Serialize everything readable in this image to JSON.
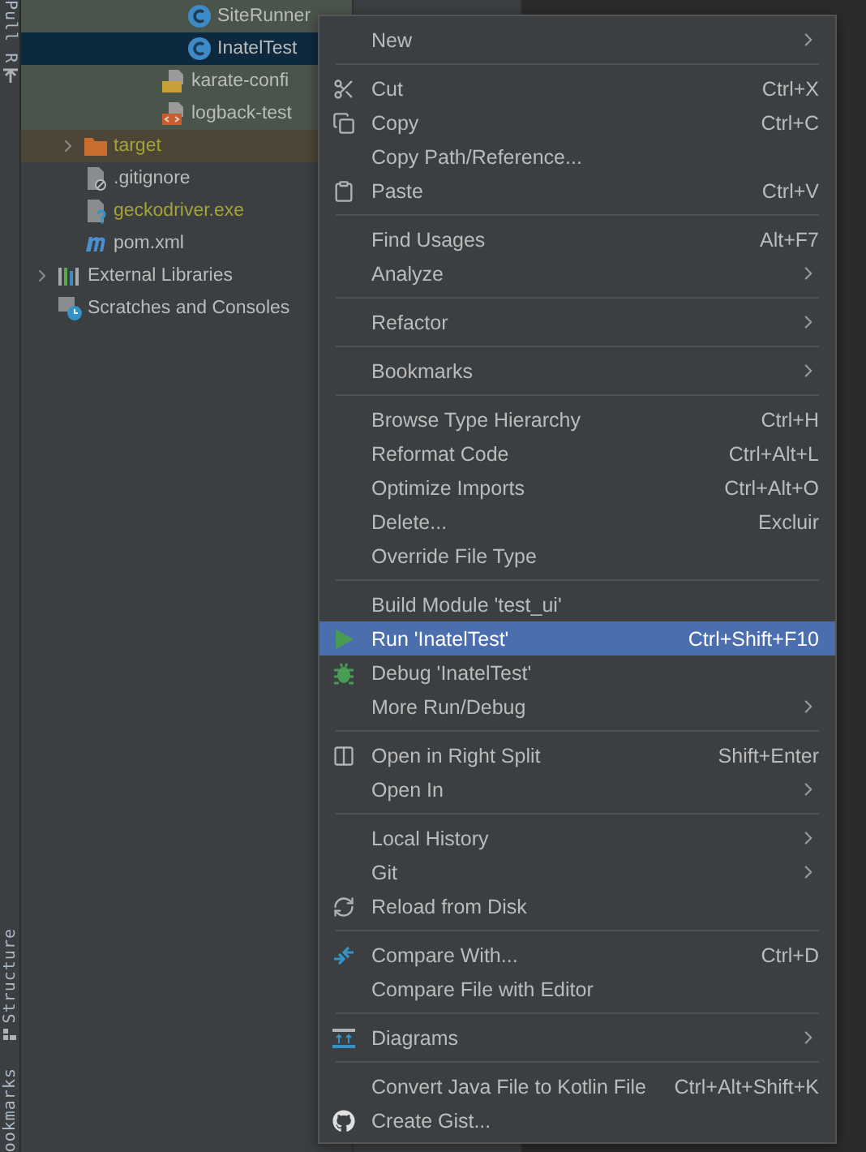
{
  "tool_strip": {
    "top_label": "Pull R",
    "bottom_labels": [
      "Structure",
      "ookmarks"
    ]
  },
  "tree": [
    {
      "children": [
        {
          "children": [
            {
              "children": [
                {
                  "children": [
                    {
                      "children": [
                        {
                          "label": "SiteRunner",
                          "kind": "class",
                          "color": "#49544a",
                          "selected": false
                        },
                        {
                          "label": "InatelTest",
                          "kind": "class",
                          "selected": true
                        }
                      ]
                    },
                    {
                      "label": "karate-confi",
                      "kind": "js",
                      "color": "#49544a",
                      "selected": false
                    },
                    {
                      "label": "logback-test",
                      "kind": "xml",
                      "color": "#49544a",
                      "selected": false
                    }
                  ]
                }
              ]
            }
          ]
        },
        {
          "label": "target",
          "kind": "folder",
          "color": "#4d4636",
          "ignored": true,
          "expanded": false,
          "selected": false
        },
        {
          "label": ".gitignore",
          "kind": "gitignore",
          "ignored": false,
          "selected": false
        },
        {
          "label": "geckodriver.exe",
          "kind": "unknown",
          "ignored": true,
          "selected": false
        },
        {
          "label": "pom.xml",
          "kind": "maven",
          "ignored": false,
          "selected": false
        }
      ]
    },
    {
      "label": "External Libraries",
      "kind": "library",
      "expanded": false,
      "selected": false
    },
    {
      "label": "Scratches and Consoles",
      "kind": "scratches",
      "selected": false
    }
  ],
  "context_menu": [
    {
      "kind": "item",
      "label": "New",
      "submenu": true,
      "highlighted": false
    },
    {
      "kind": "separator"
    },
    {
      "kind": "cut",
      "label": "Cut",
      "shortcut": "Ctrl+X",
      "highlighted": false
    },
    {
      "kind": "copy",
      "label": "Copy",
      "shortcut": "Ctrl+C",
      "highlighted": false
    },
    {
      "kind": "item",
      "label": "Copy Path/Reference...",
      "highlighted": false
    },
    {
      "kind": "paste",
      "label": "Paste",
      "shortcut": "Ctrl+V",
      "highlighted": false
    },
    {
      "kind": "separator"
    },
    {
      "kind": "item",
      "label": "Find Usages",
      "shortcut": "Alt+F7",
      "highlighted": false
    },
    {
      "kind": "item",
      "label": "Analyze",
      "submenu": true,
      "highlighted": false
    },
    {
      "kind": "separator"
    },
    {
      "kind": "item",
      "label": "Refactor",
      "submenu": true,
      "highlighted": false
    },
    {
      "kind": "separator"
    },
    {
      "kind": "item",
      "label": "Bookmarks",
      "submenu": true,
      "highlighted": false
    },
    {
      "kind": "separator"
    },
    {
      "kind": "item",
      "label": "Browse Type Hierarchy",
      "shortcut": "Ctrl+H",
      "highlighted": false
    },
    {
      "kind": "item",
      "label": "Reformat Code",
      "shortcut": "Ctrl+Alt+L",
      "highlighted": false
    },
    {
      "kind": "item",
      "label": "Optimize Imports",
      "shortcut": "Ctrl+Alt+O",
      "highlighted": false
    },
    {
      "kind": "item",
      "label": "Delete...",
      "shortcut": "Excluir",
      "highlighted": false
    },
    {
      "kind": "item",
      "label": "Override File Type",
      "highlighted": false
    },
    {
      "kind": "separator"
    },
    {
      "kind": "item",
      "label": "Build Module 'test_ui'",
      "highlighted": false
    },
    {
      "kind": "run",
      "label": "Run 'InatelTest'",
      "shortcut": "Ctrl+Shift+F10",
      "highlighted": true
    },
    {
      "kind": "debug",
      "label": "Debug 'InatelTest'",
      "highlighted": false
    },
    {
      "kind": "item",
      "label": "More Run/Debug",
      "submenu": true,
      "highlighted": false
    },
    {
      "kind": "separator"
    },
    {
      "kind": "split",
      "label": "Open in Right Split",
      "shortcut": "Shift+Enter",
      "highlighted": false
    },
    {
      "kind": "item",
      "label": "Open In",
      "submenu": true,
      "highlighted": false
    },
    {
      "kind": "separator"
    },
    {
      "kind": "item",
      "label": "Local History",
      "submenu": true,
      "highlighted": false
    },
    {
      "kind": "item",
      "label": "Git",
      "submenu": true,
      "highlighted": false
    },
    {
      "kind": "reload",
      "label": "Reload from Disk",
      "highlighted": false
    },
    {
      "kind": "separator"
    },
    {
      "kind": "compare",
      "label": "Compare With...",
      "shortcut": "Ctrl+D",
      "highlighted": false
    },
    {
      "kind": "item",
      "label": "Compare File with Editor",
      "highlighted": false
    },
    {
      "kind": "separator"
    },
    {
      "kind": "diagram",
      "label": "Diagrams",
      "submenu": true,
      "highlighted": false
    },
    {
      "kind": "separator"
    },
    {
      "kind": "item",
      "label": "Convert Java File to Kotlin File",
      "shortcut": "Ctrl+Alt+Shift+K",
      "highlighted": false
    },
    {
      "kind": "github",
      "label": "Create Gist...",
      "highlighted": false
    }
  ]
}
